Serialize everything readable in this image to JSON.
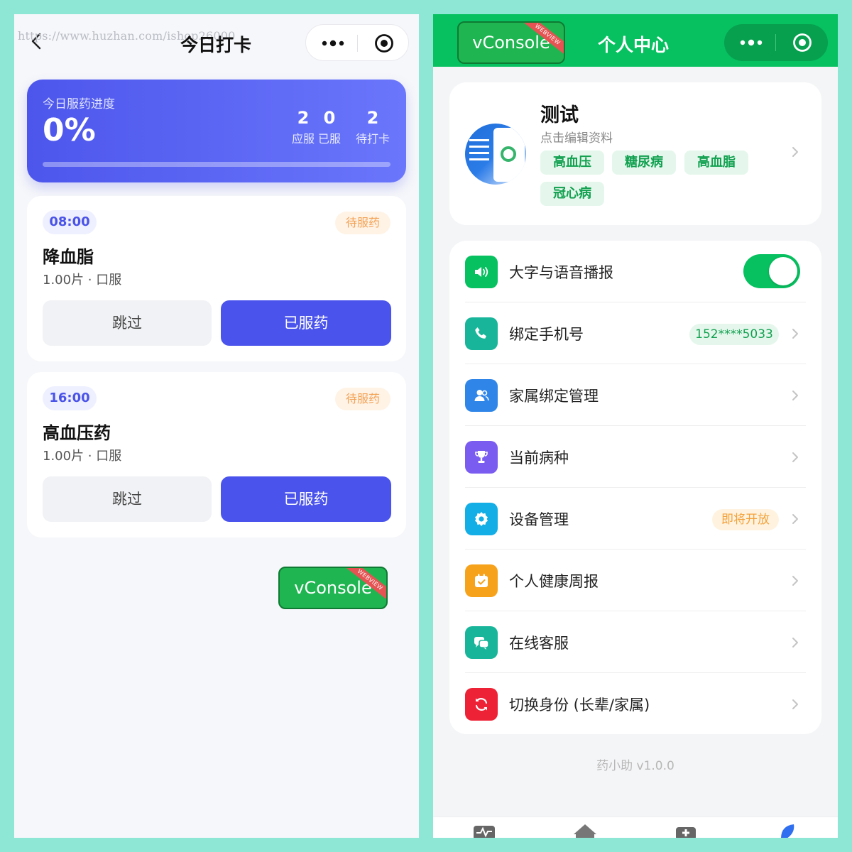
{
  "left": {
    "watermark": "https://www.huzhan.com/ishop26000",
    "title": "今日打卡",
    "progress": {
      "label": "今日服药进度",
      "percent_text": "0%",
      "fill_fraction": 0,
      "stats": [
        {
          "value": "2",
          "label": "应服"
        },
        {
          "value": "0",
          "label": "已服"
        },
        {
          "value": "2",
          "label": "待打卡"
        }
      ]
    },
    "medications": [
      {
        "time": "08:00",
        "status": "待服药",
        "name": "降血脂",
        "dose": "1.00片 · 口服",
        "skip": "跳过",
        "taken": "已服药"
      },
      {
        "time": "16:00",
        "status": "待服药",
        "name": "高血压药",
        "dose": "1.00片 · 口服",
        "skip": "跳过",
        "taken": "已服药"
      }
    ],
    "vconsole": "vConsole",
    "ribbon": "WEBVIEW"
  },
  "right": {
    "vconsole": "vConsole",
    "ribbon": "WEBVIEW",
    "title": "个人中心",
    "profile": {
      "name": "测试",
      "edit_hint": "点击编辑资料",
      "tags": [
        "高血压",
        "糖尿病",
        "高血脂",
        "冠心病"
      ]
    },
    "menu": [
      {
        "label": "大字与语音播报",
        "icon": "speaker-icon",
        "color": "#07c160",
        "toggle_on": true
      },
      {
        "label": "绑定手机号",
        "icon": "phone-icon",
        "color": "#19b59a",
        "pill": "152****5033"
      },
      {
        "label": "家属绑定管理",
        "icon": "family-icon",
        "color": "#2f86e8"
      },
      {
        "label": "当前病种",
        "icon": "trophy-icon",
        "color": "#7b5cf0"
      },
      {
        "label": "设备管理",
        "icon": "gear-icon",
        "color": "#14aee6",
        "pill": "即将开放"
      },
      {
        "label": "个人健康周报",
        "icon": "calendar-icon",
        "color": "#f7a21b"
      },
      {
        "label": "在线客服",
        "icon": "chat-icon",
        "color": "#19b59a"
      },
      {
        "label": "切换身份 (长辈/家属)",
        "icon": "switch-icon",
        "color": "#ee2236"
      }
    ],
    "version": "药小助 v1.0.0"
  },
  "colors": {
    "primary_blue": "#4a53ec",
    "wechat_green": "#07c160",
    "pending_orange": "#f3a255",
    "background_mint": "#8ee6d4"
  }
}
